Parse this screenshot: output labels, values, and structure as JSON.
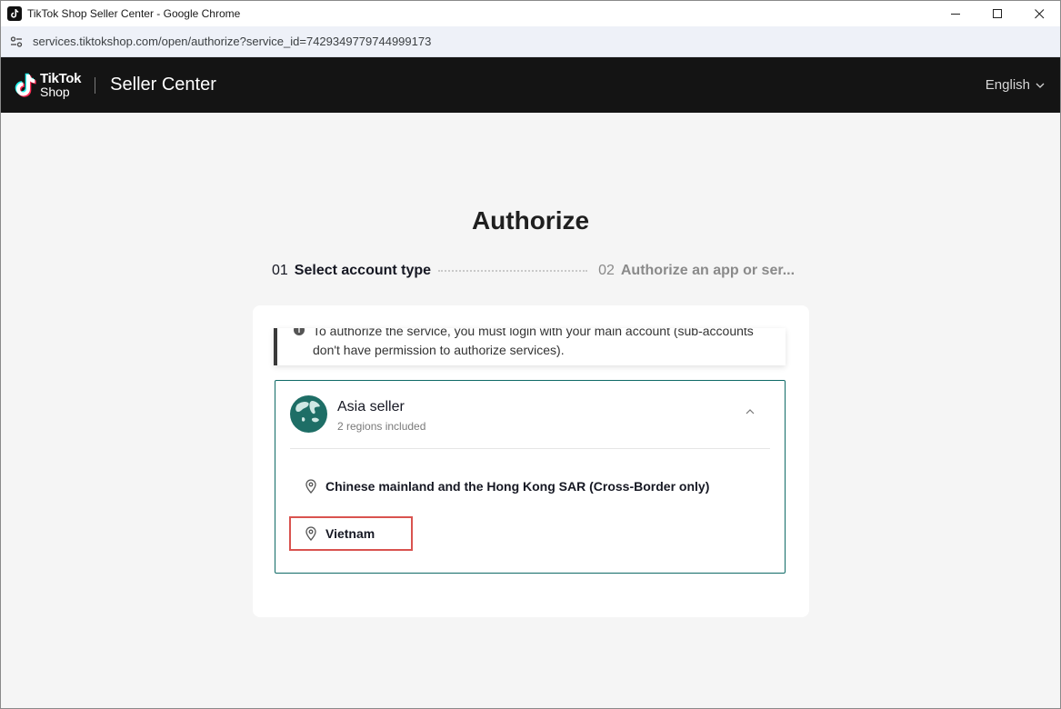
{
  "window": {
    "title": "TikTok Shop Seller Center - Google Chrome",
    "url": "services.tiktokshop.com/open/authorize?service_id=7429349779744999173"
  },
  "header": {
    "logo_line1": "TikTok",
    "logo_line2": "Shop",
    "title": "Seller Center",
    "language": "English"
  },
  "main": {
    "title": "Authorize",
    "steps": [
      {
        "num": "01",
        "label": "Select account type"
      },
      {
        "num": "02",
        "label": "Authorize an app or ser..."
      }
    ],
    "notice": "To authorize the service, you must login with your main account (sub-accounts don't have permission to authorize services).",
    "seller": {
      "name": "Asia seller",
      "subtitle": "2 regions included",
      "regions": [
        "Chinese mainland and the Hong Kong SAR (Cross-Border only)",
        "Vietnam"
      ]
    }
  },
  "colors": {
    "header_bg": "#141414",
    "accent_teal": "#0f6a66",
    "highlight_red": "#d9534f"
  }
}
